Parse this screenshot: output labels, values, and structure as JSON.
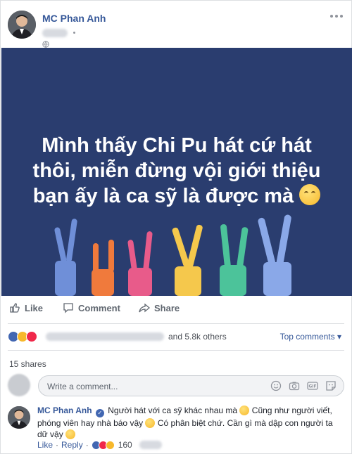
{
  "post": {
    "author": "MC Phan Anh",
    "hero_text_lines": [
      "Mình thấy Chi Pu hát cứ hát",
      "thôi, miễn đừng vội giới thiệu",
      "bạn ấy là ca sỹ là được mà"
    ],
    "hero_emoji": "smiling-face-icon"
  },
  "actions": {
    "like": "Like",
    "comment": "Comment",
    "share": "Share"
  },
  "reactions": {
    "icons": [
      "like-icon",
      "haha-icon",
      "love-icon"
    ],
    "others_text": "and 5.8k others",
    "top_comments": "Top comments ▾"
  },
  "shares": "15 shares",
  "compose": {
    "placeholder": "Write a comment..."
  },
  "comment": {
    "author": "MC Phan Anh",
    "text_1": "Người hát với ca sỹ khác nhau mà",
    "text_2": "Cũng như người viết, phóng viên hay nhà báo vậy",
    "text_3": "Có phân biệt chứ. Cần gì mà dập con người ta dữ vậy",
    "like": "Like",
    "reply": "Reply",
    "count": "160"
  },
  "colors": {
    "link": "#365899",
    "hero_bg": "#2a3d6f",
    "fb_blue": "#4267b2"
  }
}
